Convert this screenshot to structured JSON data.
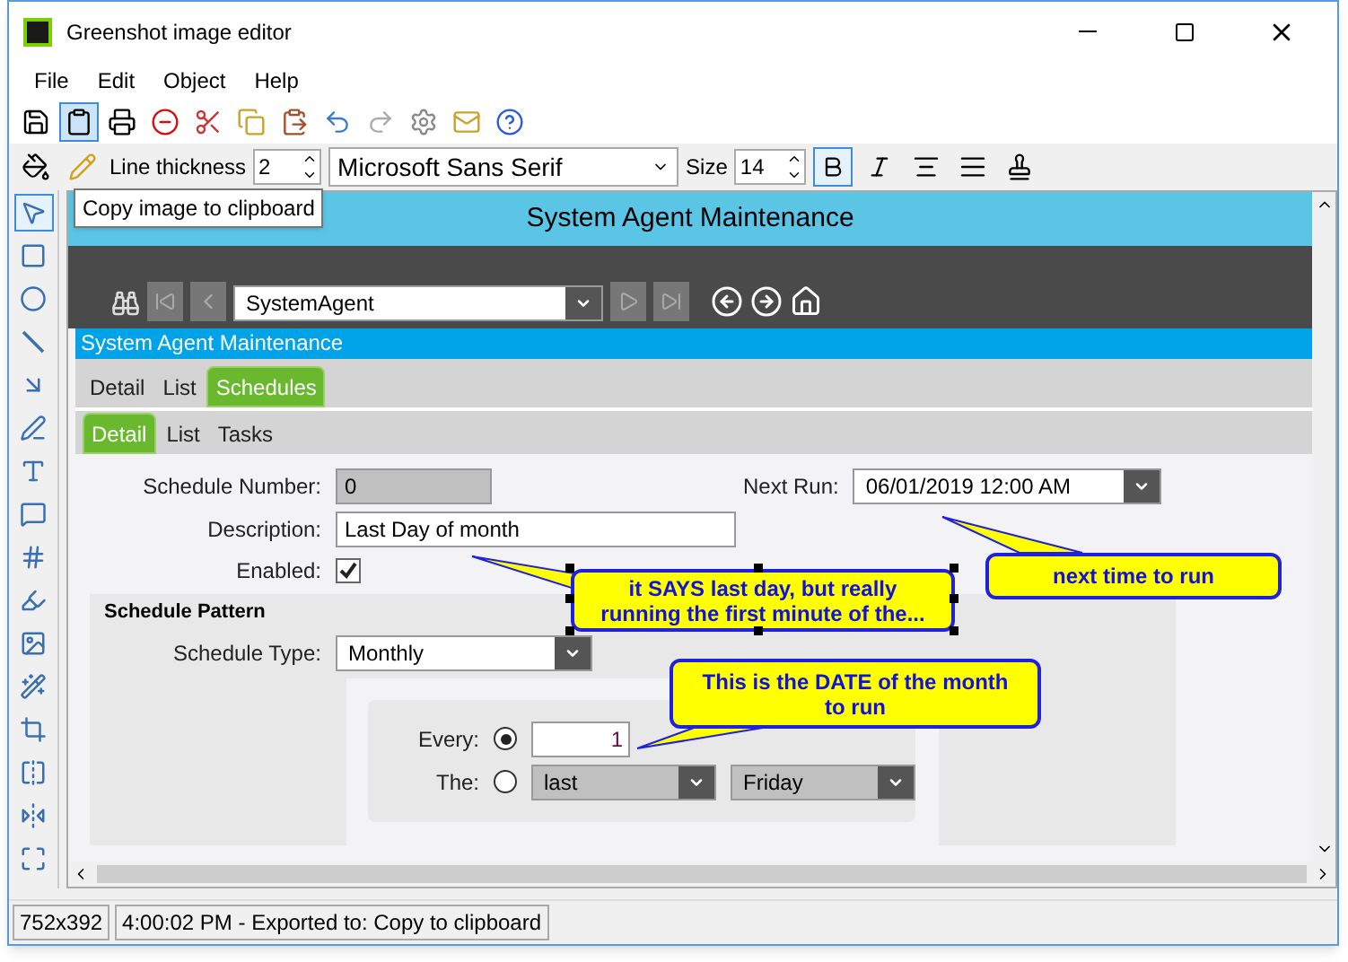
{
  "window": {
    "title": "Greenshot image editor"
  },
  "menu": [
    "File",
    "Edit",
    "Object",
    "Help"
  ],
  "toolbar": {
    "line_thickness_label": "Line thickness",
    "line_thickness": "2",
    "font": "Microsoft Sans Serif",
    "size_label": "Size",
    "size": "14",
    "bold": true,
    "italic": false
  },
  "tooltip": "Copy image to clipboard",
  "canvas": {
    "app_title": "System Agent Maintenance",
    "record": "SystemAgent",
    "section_title": "System Agent Maintenance",
    "tabs": [
      {
        "label": "Detail",
        "selected": false
      },
      {
        "label": "List",
        "selected": false
      },
      {
        "label": "Schedules",
        "selected": true
      }
    ],
    "subtabs": [
      {
        "label": "Detail",
        "selected": true
      },
      {
        "label": "List",
        "selected": false
      },
      {
        "label": "Tasks",
        "selected": false
      }
    ],
    "schedule_number": {
      "label": "Schedule Number:",
      "value": "0",
      "disabled": true
    },
    "description": {
      "label": "Description:",
      "value": "Last Day of month"
    },
    "enabled": {
      "label": "Enabled:",
      "checked": true
    },
    "next_run": {
      "label": "Next Run:",
      "value": "06/01/2019 12:00 AM"
    },
    "pattern": {
      "title": "Schedule Pattern",
      "type_label": "Schedule Type:",
      "type": "Monthly",
      "options": [
        {
          "label": "Every:",
          "selected": true,
          "value": "1"
        },
        {
          "label": "The:",
          "selected": false,
          "ordinal": "last",
          "weekday": "Friday"
        }
      ]
    },
    "callouts": [
      "it SAYS last day, but really running the first minute of the...",
      "next time to run",
      "This is the DATE of the month to run"
    ]
  },
  "status_bar": [
    "752x392",
    "4:00:02 PM - Exported to: Copy to clipboard"
  ]
}
